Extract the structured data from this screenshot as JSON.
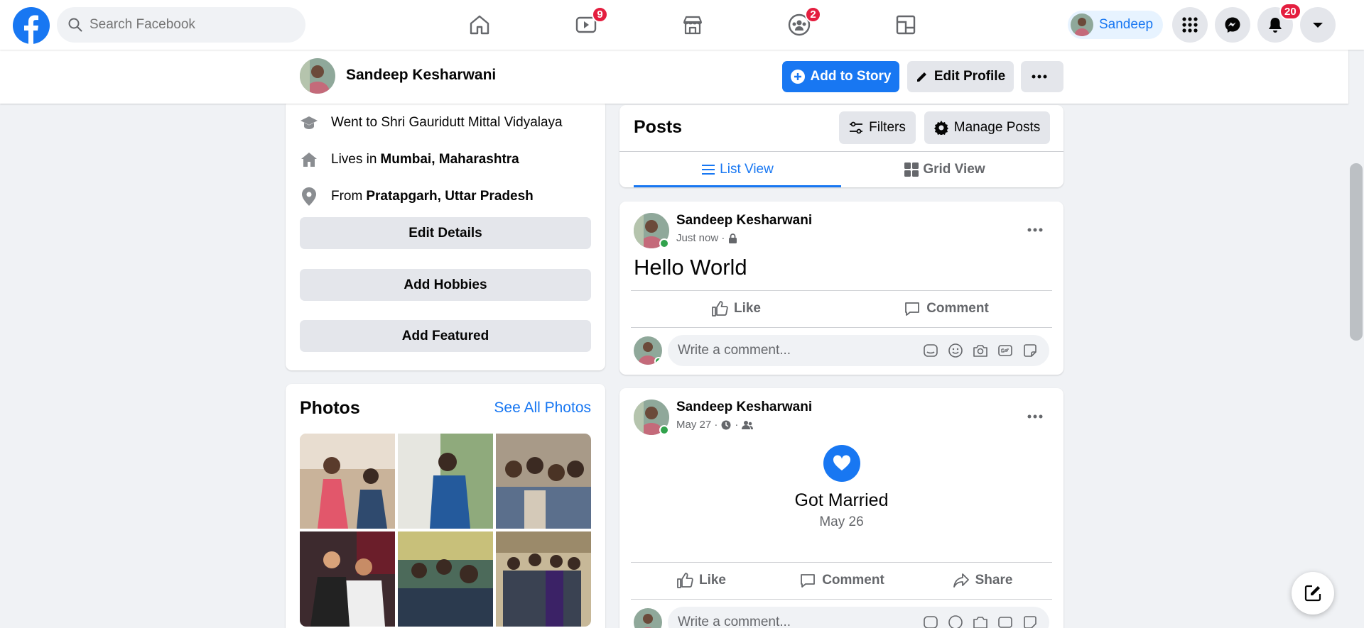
{
  "topnav": {
    "search_placeholder": "Search Facebook",
    "watch_badge": "9",
    "groups_badge": "2",
    "user_short_name": "Sandeep",
    "notifications_badge": "20"
  },
  "profile_bar": {
    "name": "Sandeep Kesharwani",
    "add_story_label": "Add to Story",
    "edit_profile_label": "Edit Profile"
  },
  "intro": {
    "education": "Went to Shri Gauridutt Mittal Vidyalaya",
    "lives_prefix": "Lives in",
    "lives_place": "Mumbai, Maharashtra",
    "from_prefix": "From",
    "from_place": "Pratapgarh, Uttar Pradesh",
    "edit_details": "Edit Details",
    "add_hobbies": "Add Hobbies",
    "add_featured": "Add Featured"
  },
  "photos": {
    "title": "Photos",
    "see_all": "See All Photos"
  },
  "posts_header": {
    "title": "Posts",
    "filters": "Filters",
    "manage_posts": "Manage Posts",
    "list_view": "List View",
    "grid_view": "Grid View"
  },
  "post1": {
    "author": "Sandeep Kesharwani",
    "time": "Just now ·",
    "text": "Hello World",
    "like": "Like",
    "comment": "Comment",
    "comment_placeholder": "Write a comment..."
  },
  "post2": {
    "author": "Sandeep Kesharwani",
    "time": "May 27 ·",
    "event_title": "Got Married",
    "event_date": "May 26",
    "like": "Like",
    "comment": "Comment",
    "share": "Share",
    "comment_placeholder": "Write a comment..."
  },
  "colors": {
    "brand": "#1877f2",
    "badge": "#e41e3f",
    "online": "#31a24c"
  }
}
